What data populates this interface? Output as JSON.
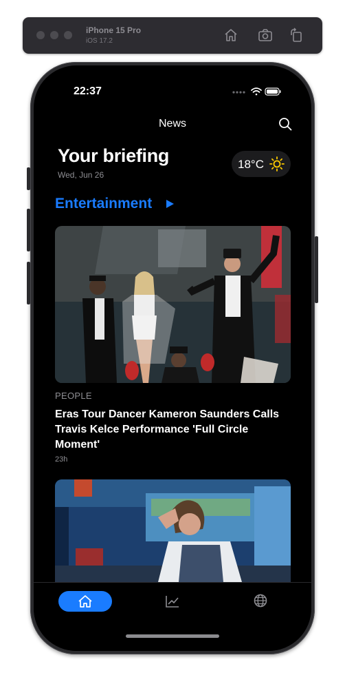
{
  "simulator": {
    "device_name": "iPhone 15 Pro",
    "os_version": "iOS 17.2",
    "icons": [
      "home-icon",
      "camera-icon",
      "rotate-icon"
    ]
  },
  "status_bar": {
    "time": "22:37"
  },
  "nav": {
    "title": "News"
  },
  "briefing": {
    "title": "Your briefing",
    "date": "Wed, Jun 26"
  },
  "weather": {
    "temperature": "18°C",
    "icon": "sun-icon"
  },
  "section": {
    "title": "Entertainment"
  },
  "stories": [
    {
      "source": "PEOPLE",
      "headline": "Eras Tour Dancer Kameron Saunders Calls Travis Kelce Performance 'Full Circle Moment'",
      "time": "23h"
    }
  ],
  "tabs": [
    {
      "name": "home-icon",
      "selected": true
    },
    {
      "name": "chart-icon",
      "selected": false
    },
    {
      "name": "globe-icon",
      "selected": false
    }
  ],
  "colors": {
    "accent": "#1a7cff",
    "background": "#000000",
    "secondary_text": "#8e8e93"
  }
}
